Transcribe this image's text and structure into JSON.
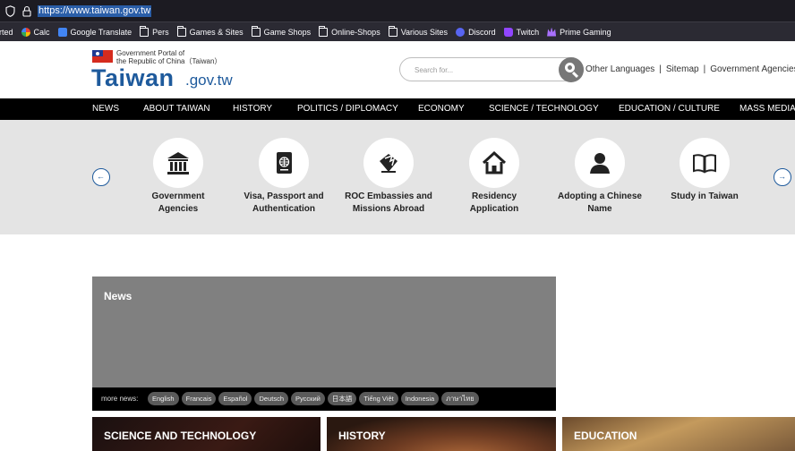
{
  "browser": {
    "url": "https://www.taiwan.gov.tw",
    "bookmarks": [
      {
        "label": "rted",
        "icon": "none"
      },
      {
        "label": "Calc",
        "icon": "google-icon"
      },
      {
        "label": "Google Translate",
        "icon": "google-translate-icon"
      },
      {
        "label": "Pers",
        "icon": "folder-icon"
      },
      {
        "label": "Games & Sites",
        "icon": "folder-icon"
      },
      {
        "label": "Game Shops",
        "icon": "folder-icon"
      },
      {
        "label": "Online-Shops",
        "icon": "folder-icon"
      },
      {
        "label": "Various Sites",
        "icon": "folder-icon"
      },
      {
        "label": "Discord",
        "icon": "discord-icon"
      },
      {
        "label": "Twitch",
        "icon": "twitch-icon"
      },
      {
        "label": "Prime Gaming",
        "icon": "prime-gaming-icon"
      }
    ]
  },
  "header": {
    "portal_line1": "Government Portal of",
    "portal_line2": "the Republic of China（Taiwan）",
    "brand": "Taiwan",
    "brand_suffix": ".gov.tw",
    "search_placeholder": "Search for...",
    "links": [
      "Other Languages",
      "Sitemap",
      "Government Agencies"
    ]
  },
  "nav": [
    "NEWS",
    "ABOUT TAIWAN",
    "HISTORY",
    "POLITICS / DIPLOMACY",
    "ECONOMY",
    "SCIENCE / TECHNOLOGY",
    "EDUCATION / CULTURE",
    "MASS MEDIA"
  ],
  "services": [
    {
      "line1": "Government",
      "line2": "Agencies",
      "icon": "government-building-icon"
    },
    {
      "line1": "Visa, Passport and",
      "line2": "Authentication",
      "icon": "passport-icon"
    },
    {
      "line1": "ROC Embassies and",
      "line2": "Missions Abroad",
      "icon": "embassy-flag-icon"
    },
    {
      "line1": "Residency",
      "line2": "Application",
      "icon": "house-icon"
    },
    {
      "line1": "Adopting a Chinese",
      "line2": "Name",
      "icon": "person-icon"
    },
    {
      "line1": "Study in Taiwan",
      "line2": "",
      "icon": "book-icon"
    }
  ],
  "news": {
    "title": "News",
    "more_label": "more news:",
    "languages": [
      "English",
      "Francais",
      "Español",
      "Deutsch",
      "Русский",
      "日本語",
      "Tiếng Việt",
      "Indonesia",
      "ภาษาไทย"
    ]
  },
  "tiles": [
    "SCIENCE AND TECHNOLOGY",
    "HISTORY",
    "EDUCATION"
  ],
  "colors": {
    "brand_blue": "#1e5a9c",
    "nav_bg": "#000000",
    "carousel_bg": "#e4e4e4",
    "news_bg": "#808080"
  }
}
